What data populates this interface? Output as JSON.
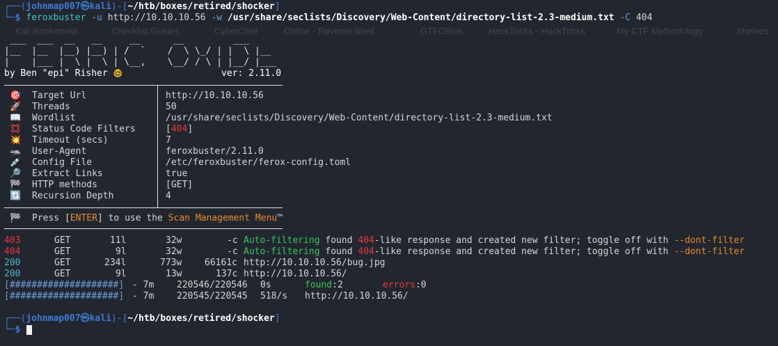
{
  "prompt1": {
    "user": "johnmap007",
    "host": "kali",
    "cwd": "~/htb/boxes/retired/shocker",
    "dollar": "$",
    "at": "㉿",
    "open_top": "┌──(",
    "mid": ")-[",
    "close": "]",
    "open_bot": "└─"
  },
  "command": {
    "name": "feroxbuster",
    "flag_u": "-u",
    "url": "http://10.10.10.56",
    "flag_w": "-w",
    "wordlist": "/usr/share/seclists/Discovery/Web-Content/directory-list-2.3-medium.txt",
    "flag_c": "-C",
    "code": "404"
  },
  "ghost_bookmarks": [
    "Kali Bookmarks",
    "Checklist Guides",
    "CyberChef",
    "Online - Reverse Shell",
    "GTFOBins",
    "HackTricks - HackTricks",
    "My CTF Methodology",
    "Shelves"
  ],
  "banner": {
    "art_line1": " ___  ___  __   __     __      __         ___",
    "art_line2": "|__  |__  |__) |__) | /  `    /  \\ \\_/ | |  \\ |__",
    "art_line3": "|    |___ |  \\ |  \\ | \\__,    \\__/ / \\ | |__/ |___",
    "byline": "by Ben \"epi\" Risher",
    "byline_emoji": "🤓",
    "version": "ver: 2.11.0"
  },
  "config": [
    {
      "icon": "target-icon",
      "glyph": "🎯",
      "label": "Target Url",
      "value": "http://10.10.10.56"
    },
    {
      "icon": "rocket-icon",
      "glyph": "🚀",
      "label": "Threads",
      "value": "50"
    },
    {
      "icon": "book-icon",
      "glyph": "📖",
      "label": "Wordlist",
      "value": "/usr/share/seclists/Discovery/Web-Content/directory-list-2.3-medium.txt"
    },
    {
      "icon": "collision-icon",
      "glyph": "💢",
      "label": "Status Code Filters",
      "value_pre": "[",
      "value": "404",
      "value_post": "]"
    },
    {
      "icon": "timer-icon",
      "glyph": "💥",
      "label": "Timeout (secs)",
      "value": "7"
    },
    {
      "icon": "crab-icon",
      "glyph": "🦡",
      "label": "User-Agent",
      "value": "feroxbuster/2.11.0"
    },
    {
      "icon": "syringe-icon",
      "glyph": "💉",
      "label": "Config File",
      "value": "/etc/feroxbuster/ferox-config.toml"
    },
    {
      "icon": "magnifier-icon",
      "glyph": "🔎",
      "label": "Extract Links",
      "value": "true"
    },
    {
      "icon": "flag-icon",
      "glyph": "🏁",
      "label": "HTTP methods",
      "value": "[GET]"
    },
    {
      "icon": "repeat-icon",
      "glyph": "🔃",
      "label": "Recursion Depth",
      "value": "4"
    }
  ],
  "press": {
    "glyph": "🏁",
    "pre": "Press [",
    "key": "ENTER",
    "mid": "] to use the ",
    "menu": "Scan Management Menu",
    "tm": "™"
  },
  "results": [
    {
      "status": "403",
      "method": "GET",
      "lines": "11l",
      "words": "32w",
      "size": "-c",
      "filter": true,
      "auto": "Auto-filtering",
      "found": " found ",
      "code": "404",
      "tail": "-like response and created new filter; toggle off with ",
      "opt": "--dont-filter"
    },
    {
      "status": "404",
      "method": "GET",
      "lines": "9l",
      "words": "32w",
      "size": "-c",
      "filter": true,
      "auto": "Auto-filtering",
      "found": " found ",
      "code": "404",
      "tail": "-like response and created new filter; toggle off with ",
      "opt": "--dont-filter"
    },
    {
      "status": "200",
      "method": "GET",
      "lines": "234l",
      "words": "773w",
      "size": "66161c",
      "filter": false,
      "url": "http://10.10.10.56/bug.jpg"
    },
    {
      "status": "200",
      "method": "GET",
      "lines": "9l",
      "words": "13w",
      "size": "137c",
      "filter": false,
      "url": "http://10.10.10.56/"
    }
  ],
  "progress": [
    {
      "bar": "[####################]",
      "elapsed": "- 7m",
      "count": "220546/220546",
      "rate": "0s",
      "found_label": "found",
      "found_val": ":2",
      "err_label": "errors",
      "err_val": ":0",
      "progress": 1.0
    },
    {
      "bar": "[####################]",
      "elapsed": "- 7m",
      "count": "220545/220545",
      "rate": "518/s",
      "url": "http://10.10.10.56/",
      "progress": 1.0
    }
  ],
  "prompt2": {
    "user": "johnmap007",
    "host": "kali",
    "cwd": "~/htb/boxes/retired/shocker",
    "dollar": "$"
  }
}
